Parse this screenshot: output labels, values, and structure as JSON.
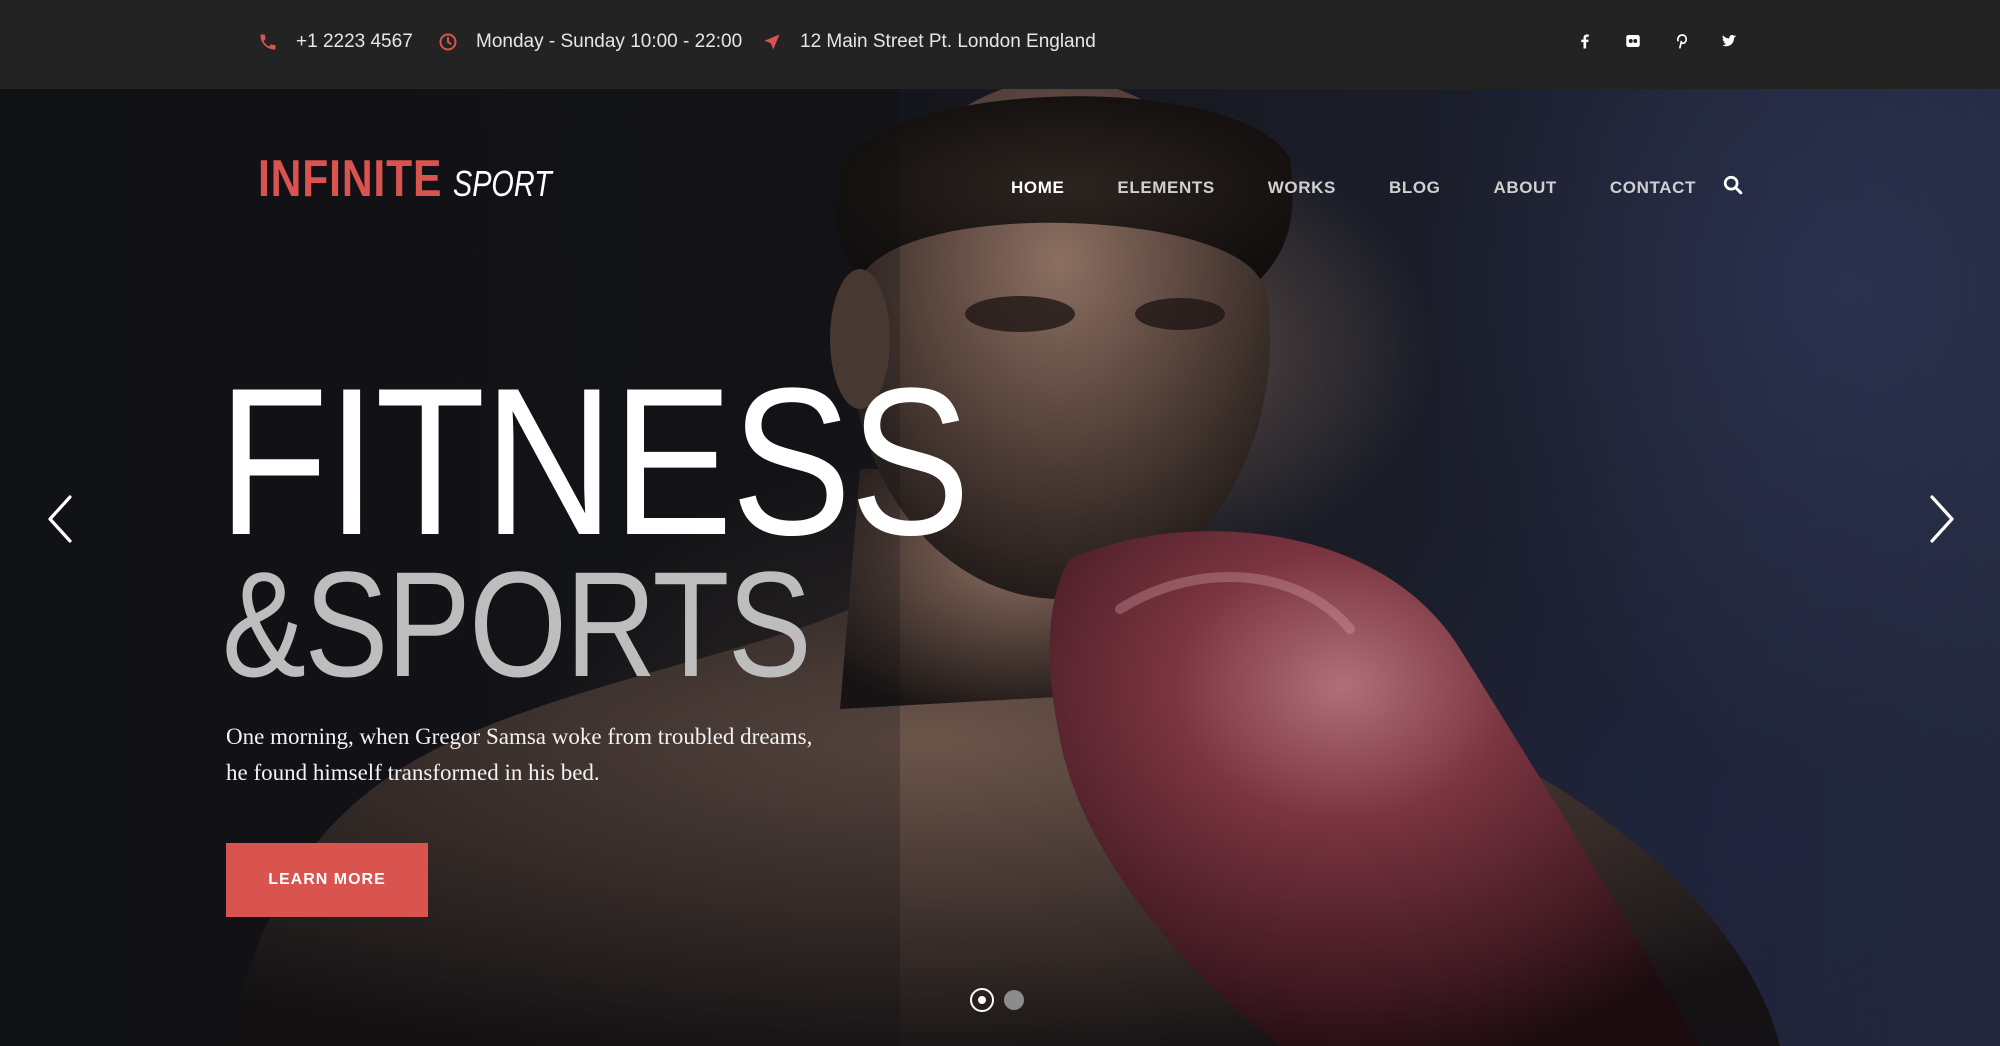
{
  "topbar": {
    "phone": "+1 2223 4567",
    "hours": "Monday - Sunday 10:00 - 22:00",
    "address": "12 Main Street Pt. London England",
    "icons": {
      "phone": "phone-icon",
      "hours": "clock-icon",
      "address": "location-arrow-icon"
    },
    "social": [
      "facebook-icon",
      "flickr-icon",
      "pinterest-icon",
      "twitter-icon"
    ]
  },
  "logo": {
    "strong": "INFINITE",
    "light": "SPORT"
  },
  "nav": {
    "items": [
      "HOME",
      "ELEMENTS",
      "WORKS",
      "BLOG",
      "ABOUT",
      "CONTACT"
    ],
    "active": "HOME",
    "search_icon": "search-icon"
  },
  "hero": {
    "headline": "FITNESS",
    "subheadline": "&SPORTS",
    "description_line1": "One morning, when Gregor Samsa woke from troubled dreams,",
    "description_line2": "he found himself transformed in his bed.",
    "cta_label": "LEARN MORE",
    "prev_icon": "chevron-left-icon",
    "next_icon": "chevron-right-icon",
    "slides_total": 2,
    "slide_current": 1
  },
  "colors": {
    "accent": "#d9534f",
    "topbar_bg": "#232323",
    "text_light": "#ffffff",
    "text_muted": "#bdbdbd"
  }
}
